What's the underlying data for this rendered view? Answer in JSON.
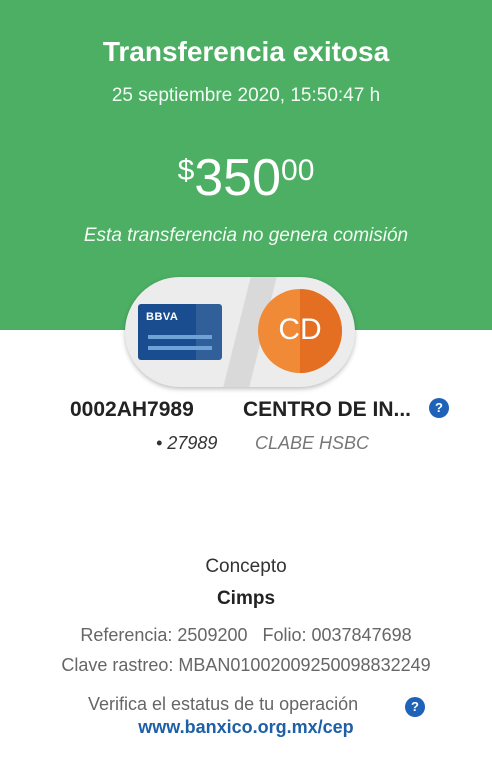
{
  "header": {
    "title": "Transferencia exitosa",
    "datetime": "25 septiembre 2020, 15:50:47 h",
    "amount": {
      "currency_symbol": "$",
      "integer": "350",
      "cents": "00"
    },
    "commission_note": "Esta transferencia no genera comisión",
    "background_color": "#4caf64"
  },
  "origin": {
    "bank_logo_text": "BBVA",
    "account_number": "0002AH7989",
    "account_suffix": "• 27989"
  },
  "destination": {
    "initials": "CD",
    "name": "CENTRO DE IN...",
    "account_type": "CLABE HSBC",
    "avatar_color": "#f08a36"
  },
  "details": {
    "concept_label": "Concepto",
    "concept_value": "Cimps",
    "reference_line": "Referencia: 2509200   Folio: 0037847698",
    "trace_line": "Clave rastreo: MBAN01002009250098832249"
  },
  "verify": {
    "text": "Verifica el estatus de tu operación",
    "link": "www.banxico.org.mx/cep"
  },
  "icons": {
    "info": "question-mark-icon",
    "info_glyph": "?"
  }
}
